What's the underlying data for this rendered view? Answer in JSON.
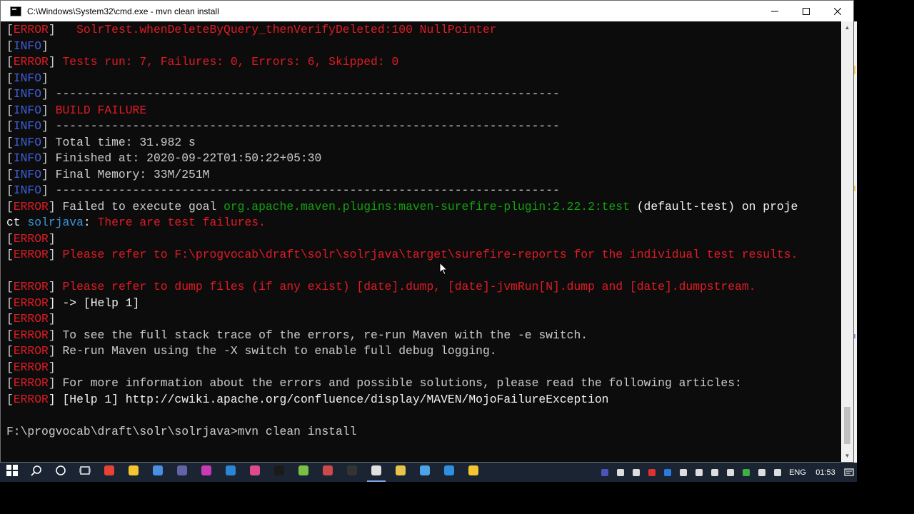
{
  "window": {
    "title": "C:\\Windows\\System32\\cmd.exe - mvn  clean install"
  },
  "console": {
    "lines": [
      [
        {
          "t": "[",
          "c": "gray"
        },
        {
          "t": "ERROR",
          "c": "err"
        },
        {
          "t": "]   ",
          "c": "gray"
        },
        {
          "t": "SolrTest.whenDeleteByQuery_thenVerifyDeleted:100 NullPointer",
          "c": "red"
        }
      ],
      [
        {
          "t": "[",
          "c": "gray"
        },
        {
          "t": "INFO",
          "c": "info"
        },
        {
          "t": "]",
          "c": "gray"
        }
      ],
      [
        {
          "t": "[",
          "c": "gray"
        },
        {
          "t": "ERROR",
          "c": "err"
        },
        {
          "t": "] ",
          "c": "gray"
        },
        {
          "t": "Tests run: 7, Failures: 0, Errors: 6, Skipped: 0",
          "c": "red"
        }
      ],
      [
        {
          "t": "[",
          "c": "gray"
        },
        {
          "t": "INFO",
          "c": "info"
        },
        {
          "t": "]",
          "c": "gray"
        }
      ],
      [
        {
          "t": "[",
          "c": "gray"
        },
        {
          "t": "INFO",
          "c": "info"
        },
        {
          "t": "] ------------------------------------------------------------------------",
          "c": "gray"
        }
      ],
      [
        {
          "t": "[",
          "c": "gray"
        },
        {
          "t": "INFO",
          "c": "info"
        },
        {
          "t": "] ",
          "c": "gray"
        },
        {
          "t": "BUILD FAILURE",
          "c": "red"
        }
      ],
      [
        {
          "t": "[",
          "c": "gray"
        },
        {
          "t": "INFO",
          "c": "info"
        },
        {
          "t": "] ------------------------------------------------------------------------",
          "c": "gray"
        }
      ],
      [
        {
          "t": "[",
          "c": "gray"
        },
        {
          "t": "INFO",
          "c": "info"
        },
        {
          "t": "] Total time: 31.982 s",
          "c": "gray"
        }
      ],
      [
        {
          "t": "[",
          "c": "gray"
        },
        {
          "t": "INFO",
          "c": "info"
        },
        {
          "t": "] Finished at: 2020-09-22T01:50:22+05:30",
          "c": "gray"
        }
      ],
      [
        {
          "t": "[",
          "c": "gray"
        },
        {
          "t": "INFO",
          "c": "info"
        },
        {
          "t": "] Final Memory: 33M/251M",
          "c": "gray"
        }
      ],
      [
        {
          "t": "[",
          "c": "gray"
        },
        {
          "t": "INFO",
          "c": "info"
        },
        {
          "t": "] ------------------------------------------------------------------------",
          "c": "gray"
        }
      ],
      [
        {
          "t": "[",
          "c": "gray"
        },
        {
          "t": "ERROR",
          "c": "err"
        },
        {
          "t": "] Failed to execute goal ",
          "c": "gray"
        },
        {
          "t": "org.apache.maven.plugins:maven-surefire-plugin:2.22.2:test",
          "c": "grn"
        },
        {
          "t": " (default-test) on proje",
          "c": "wht"
        }
      ],
      [
        {
          "t": "ct ",
          "c": "wht"
        },
        {
          "t": "solrjava",
          "c": "cyan"
        },
        {
          "t": ": ",
          "c": "wht"
        },
        {
          "t": "There are test failures.",
          "c": "red"
        }
      ],
      [
        {
          "t": "[",
          "c": "gray"
        },
        {
          "t": "ERROR",
          "c": "err"
        },
        {
          "t": "]",
          "c": "gray"
        }
      ],
      [
        {
          "t": "[",
          "c": "gray"
        },
        {
          "t": "ERROR",
          "c": "err"
        },
        {
          "t": "] ",
          "c": "gray"
        },
        {
          "t": "Please refer to F:\\progvocab\\draft\\solr\\solrjava\\target\\surefire-reports for the individual test results.",
          "c": "red"
        }
      ],
      [
        {
          "t": "",
          "c": "gray"
        }
      ],
      [
        {
          "t": "[",
          "c": "gray"
        },
        {
          "t": "ERROR",
          "c": "err"
        },
        {
          "t": "] ",
          "c": "gray"
        },
        {
          "t": "Please refer to dump files (if any exist) [date].dump, [date]-jvmRun[N].dump and [date].dumpstream.",
          "c": "red"
        }
      ],
      [
        {
          "t": "[",
          "c": "gray"
        },
        {
          "t": "ERROR",
          "c": "err"
        },
        {
          "t": "] -> [Help 1]",
          "c": "wht"
        }
      ],
      [
        {
          "t": "[",
          "c": "gray"
        },
        {
          "t": "ERROR",
          "c": "err"
        },
        {
          "t": "]",
          "c": "gray"
        }
      ],
      [
        {
          "t": "[",
          "c": "gray"
        },
        {
          "t": "ERROR",
          "c": "err"
        },
        {
          "t": "] To see the full stack trace of the errors, re-run Maven with the -e switch.",
          "c": "gray"
        }
      ],
      [
        {
          "t": "[",
          "c": "gray"
        },
        {
          "t": "ERROR",
          "c": "err"
        },
        {
          "t": "] Re-run Maven using the -X switch to enable full debug logging.",
          "c": "gray"
        }
      ],
      [
        {
          "t": "[",
          "c": "gray"
        },
        {
          "t": "ERROR",
          "c": "err"
        },
        {
          "t": "]",
          "c": "gray"
        }
      ],
      [
        {
          "t": "[",
          "c": "gray"
        },
        {
          "t": "ERROR",
          "c": "err"
        },
        {
          "t": "] For more information about the errors and possible solutions, please read the following articles:",
          "c": "gray"
        }
      ],
      [
        {
          "t": "[",
          "c": "gray"
        },
        {
          "t": "ERROR",
          "c": "err"
        },
        {
          "t": "] [Help 1] http://cwiki.apache.org/confluence/display/MAVEN/MojoFailureException",
          "c": "wht"
        }
      ],
      [
        {
          "t": "",
          "c": "gray"
        }
      ],
      [
        {
          "t": "F:\\progvocab\\draft\\solr\\solrjava>mvn clean install",
          "c": "gray"
        }
      ]
    ]
  },
  "colors": {
    "error": "#e01b24",
    "info": "#3f5fd8",
    "green": "#13a10e",
    "cyan": "#3a96dd",
    "console_bg": "#0c0c0c",
    "taskbar_bg": "#1b2433"
  },
  "taskbar": {
    "items": [
      "windows-start-icon",
      "search-icon",
      "cortana-icon",
      "task-view-icon",
      "store-icon",
      "desktop-icon",
      "edge-icon",
      "sticky-notes-icon",
      "chrome-icon",
      "file-explorer-icon",
      "app-icon",
      "teams-icon",
      "media-icon",
      "vscode-icon",
      "intellij-icon",
      "cmd-icon",
      "app-icon",
      "notepad-icon",
      "github-icon",
      "app-icon"
    ],
    "tray_icons": [
      "teams-tray-icon",
      "mic-icon",
      "security-icon",
      "red-app-icon",
      "bluetooth-icon",
      "wifi-icon",
      "volume-icon",
      "display-icon",
      "app-tray-icon",
      "green-app-icon",
      "usb-icon",
      "keyboard-icon"
    ],
    "language": "ENG",
    "time": "01:53"
  }
}
